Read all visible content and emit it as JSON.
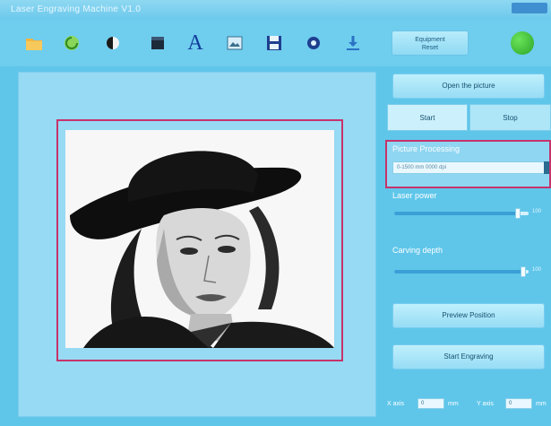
{
  "window": {
    "title": "Laser Engraving Machine V1.0"
  },
  "toolbar": {
    "tools": [
      {
        "name": "open-folder-icon"
      },
      {
        "name": "refresh-icon"
      },
      {
        "name": "grayscale-icon"
      },
      {
        "name": "invert-icon"
      },
      {
        "name": "text-icon",
        "glyph": "A"
      },
      {
        "name": "image-icon"
      },
      {
        "name": "save-icon"
      },
      {
        "name": "settings-icon"
      },
      {
        "name": "download-icon"
      }
    ],
    "restore_label_line1": "Equipment",
    "restore_label_line2": "Reset",
    "status_color": "#2aa527"
  },
  "panel": {
    "open_picture_label": "Open the picture",
    "tabs": [
      {
        "label": "Start"
      },
      {
        "label": "Stop"
      }
    ],
    "picture_processing": {
      "title": "Picture Processing",
      "field_value": "0-1500 mm  0000 dpi"
    },
    "laser_power": {
      "label": "Laser power",
      "value": "100",
      "fraction": 0.92
    },
    "carving_depth": {
      "label": "Carving depth",
      "value": "100",
      "fraction": 0.96
    },
    "preview_position_label": "Preview Position",
    "start_engraving_label": "Start Engraving",
    "coords": {
      "x_label": "X axis",
      "x_value": "0",
      "x_unit": "mm",
      "y_label": "Y axis",
      "y_value": "0",
      "y_unit": "mm"
    }
  },
  "colors": {
    "background": "#5fc6ea",
    "accent_border": "#c6336b"
  }
}
